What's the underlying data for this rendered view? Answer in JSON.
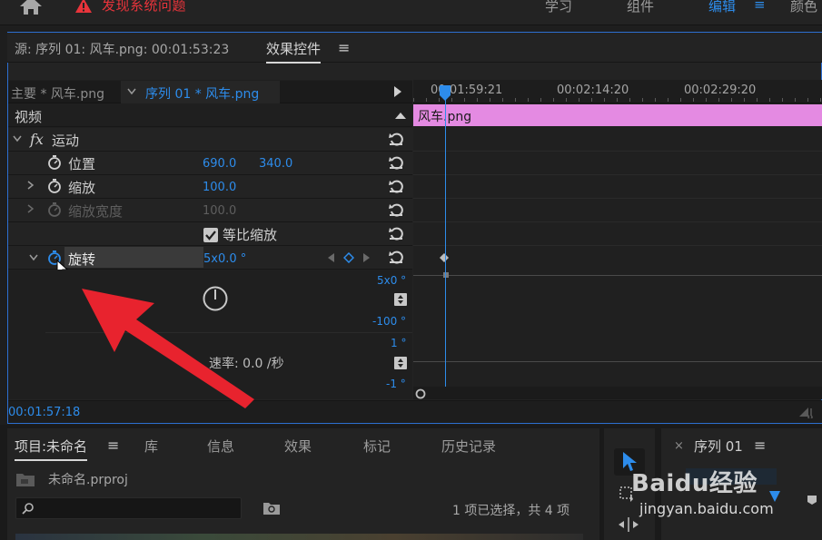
{
  "topbar": {
    "issue_text": "发现系统问题",
    "tabs": [
      "学习",
      "组件",
      "编辑",
      "颜色"
    ],
    "active_tab": "编辑",
    "menu_glyph": "≡"
  },
  "ec": {
    "source_label": "源: 序列 01: 风车.png: 00:01:53:23",
    "active_tab": "效果控件",
    "menu_glyph": "≡",
    "master_clip": "主要 * 风车.png",
    "sequence_clip": "序列 01 * 风车.png",
    "section_video": "视频",
    "fx": "fx",
    "motion": "运动",
    "position_label": "位置",
    "position_x": "690.0",
    "position_y": "340.0",
    "scale_label": "缩放",
    "scale_value": "100.0",
    "scale_width_label": "缩放宽度",
    "scale_width_value": "100.0",
    "uniform_scale_label": "等比缩放",
    "rotation_label": "旋转",
    "rotation_value": "5x0.0 °",
    "graph_top": "5x0 °",
    "graph_bottom": "-100 °",
    "velocity_label": "速率: 0.0 /秒",
    "vel_top": "1 °",
    "vel_bottom": "-1 °",
    "timecode": "00:01:57:18"
  },
  "timeline": {
    "ticks": [
      "00:01:59:21",
      "00:02:14:20",
      "00:02:29:20"
    ],
    "clip_name": "风车.png"
  },
  "project": {
    "active_tab": "项目:未命名",
    "menu_glyph": "≡",
    "tabs": [
      "库",
      "信息",
      "效果",
      "标记",
      "历史记录"
    ],
    "file_name": "未命名.prproj",
    "selection_status": "1 项已选择，共 4 项"
  },
  "sequence_panel": {
    "title": "序列 01",
    "menu_glyph": "≡",
    "close_glyph": "×"
  },
  "watermark": {
    "brand": "Baidu经验",
    "url": "jingyan.baidu.com"
  },
  "colors": {
    "accent": "#2d8ceb",
    "clip": "#e48ae2",
    "warning": "#e8343b",
    "arrow": "#e8232e"
  }
}
